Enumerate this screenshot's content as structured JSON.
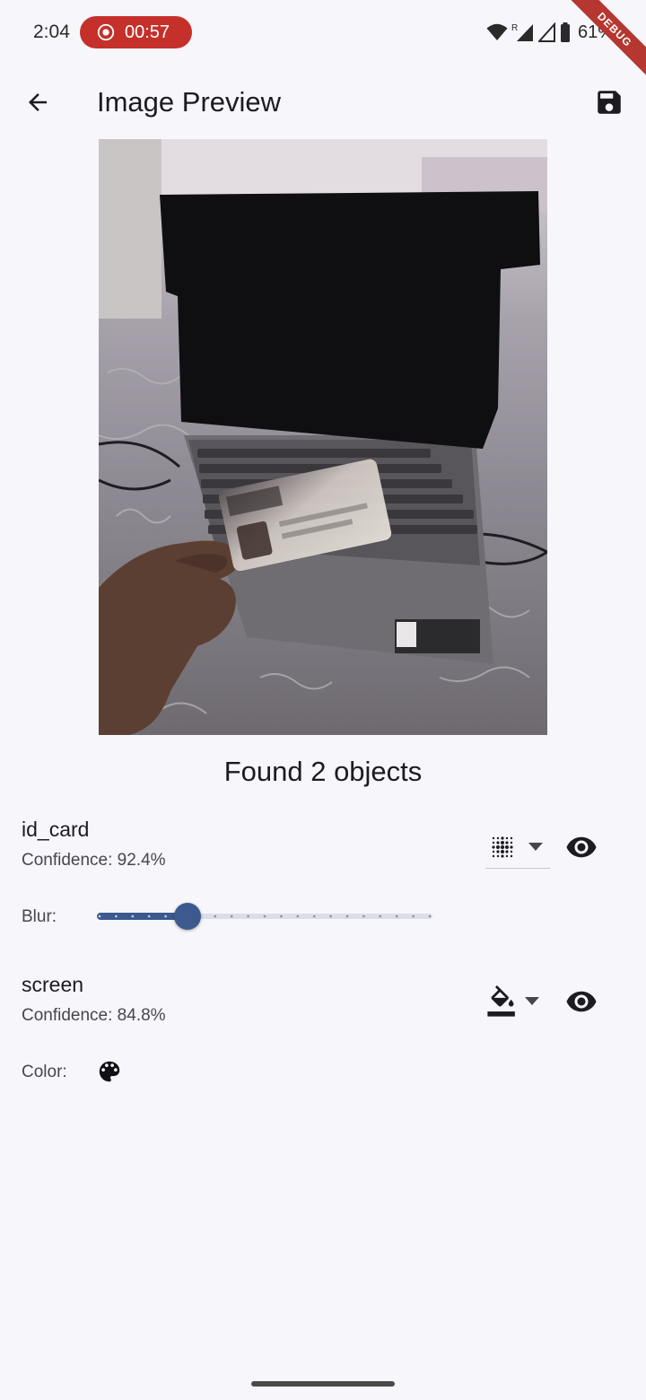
{
  "status_bar": {
    "time": "2:04",
    "recording_timer": "00:57",
    "battery_percent": "61%",
    "icons": [
      "wifi-icon",
      "signal-roaming-icon",
      "signal-icon",
      "battery-icon"
    ]
  },
  "debug_banner": "DEBUG",
  "app_bar": {
    "title": "Image Preview",
    "back_icon": "arrow-back-icon",
    "save_icon": "save-icon"
  },
  "preview": {
    "description_icon": "image-preview"
  },
  "results": {
    "heading": "Found 2 objects",
    "objects": [
      {
        "name": "id_card",
        "confidence": "Confidence: 92.4%",
        "effect_icon": "blur-dots-icon",
        "visible_icon": "eye-icon",
        "control_label": "Blur:",
        "blur_level": 0.27
      },
      {
        "name": "screen",
        "confidence": "Confidence: 84.8%",
        "effect_icon": "paint-bucket-icon",
        "visible_icon": "eye-icon",
        "control_label": "Color:",
        "color_icon": "palette-icon"
      }
    ]
  },
  "colors": {
    "accent": "#3d5a8e",
    "record_pill": "#c5302b",
    "background": "#f7f6fb"
  }
}
